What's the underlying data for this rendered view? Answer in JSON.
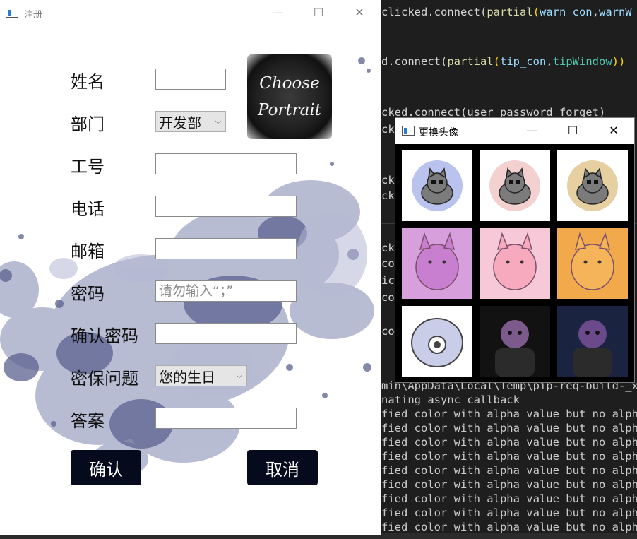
{
  "editor": {
    "code_lines": [
      {
        "parts": [
          [
            "clicked.connect(",
            ""
          ],
          [
            "partial",
            "c-fn"
          ],
          [
            "(",
            "c-par"
          ],
          [
            "warn_con",
            "c-name"
          ],
          [
            ",",
            ""
          ],
          [
            "warnW",
            "c-name"
          ]
        ]
      },
      {
        "parts": [
          [
            "d.connect(",
            ""
          ],
          [
            "partial",
            "c-fn"
          ],
          [
            "(",
            "c-par"
          ],
          [
            "tip_con",
            "c-name"
          ],
          [
            ",",
            ""
          ],
          [
            "tipWindow",
            "c-tip"
          ],
          [
            "))",
            "c-par"
          ]
        ]
      },
      {
        "parts": [
          [
            "cked.connect(user_password_forget)",
            ""
          ]
        ]
      },
      {
        "parts": [
          [
            "ck",
            ""
          ]
        ]
      },
      {
        "parts": [
          [
            "ck",
            ""
          ]
        ]
      },
      {
        "parts": [
          [
            "ck",
            ""
          ]
        ]
      },
      {
        "parts": [
          [
            "ck",
            ""
          ]
        ]
      },
      {
        "parts": [
          [
            "co",
            ""
          ]
        ]
      },
      {
        "parts": [
          [
            "ic",
            ""
          ]
        ]
      },
      {
        "parts": [
          [
            "co",
            ""
          ]
        ]
      },
      {
        "parts": [
          [
            "co",
            ""
          ]
        ]
      }
    ],
    "terminal_lines": [
      "min\\AppData\\Local\\Temp\\pip-req-build-_xlv",
      "nating async callback",
      "fied color with alpha value but no alpha",
      "fied color with alpha value but no alpha",
      "fied color with alpha value but no alpha",
      "fied color with alpha value but no alpha",
      "fied color with alpha value but no alpha",
      "fied color with alpha value but no alpha",
      "fied color with alpha value but no alpha",
      "fied color with alpha value but no alpha",
      "fied color with alpha value but no alpha"
    ]
  },
  "register": {
    "title": "注册",
    "minimize": "—",
    "maximize": "☐",
    "close": "✕",
    "labels": {
      "name": "姓名",
      "department": "部门",
      "employee_id": "工号",
      "phone": "电话",
      "email": "邮箱",
      "password": "密码",
      "confirm_password": "确认密码",
      "security_question": "密保问题",
      "answer": "答案"
    },
    "values": {
      "name": "",
      "employee_id": "",
      "phone": "",
      "email": "",
      "password": "",
      "confirm_password": "",
      "answer": ""
    },
    "password_placeholder": "请勿输入“；”",
    "department_selected": "开发部",
    "security_question_selected": "您的生日",
    "dropdown_arrow": "⌵",
    "portrait_line1": "Choose",
    "portrait_line2": "Portrait",
    "confirm_button": "确认",
    "cancel_button": "取消"
  },
  "avatar_window": {
    "title": "更换头像",
    "minimize": "—",
    "maximize": "☐",
    "close": "✕",
    "tiles": [
      {
        "icon": "gray-cat-easel-avatar",
        "bg": "#ffffff",
        "accent": "#b9c3ee"
      },
      {
        "icon": "calico-cat-sleeping-avatar",
        "bg": "#ffffff",
        "accent": "#f4d1d1"
      },
      {
        "icon": "gray-cat-sitting-avatar",
        "bg": "#ffffff",
        "accent": "#e6cfa0"
      },
      {
        "icon": "purple-blob-cat-avatar",
        "bg": "#d79fdc",
        "accent": "#c97fcf"
      },
      {
        "icon": "pink-blob-cat-surprised-avatar",
        "bg": "#f6c8d8",
        "accent": "#f7a9bd"
      },
      {
        "icon": "orange-blob-cat-crying-avatar",
        "bg": "#f2a94c",
        "accent": "#f5b45a"
      },
      {
        "icon": "robot-eye-creature-avatar",
        "bg": "#ffffff",
        "accent": "#c9cde8"
      },
      {
        "icon": "thanos-palette-avatar",
        "bg": "#121212",
        "accent": "#7d5a8c"
      },
      {
        "icon": "thanos-armor-avatar",
        "bg": "#1a2340",
        "accent": "#6b4a8c"
      }
    ]
  }
}
